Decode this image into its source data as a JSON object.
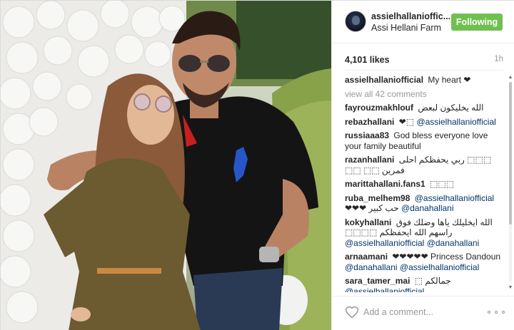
{
  "post": {
    "username": "assielhallaniofficial",
    "username_display": "assielhallanioffic...",
    "location": "Assi Hellani Farm",
    "follow_button": "Following",
    "likes": "4,101 likes",
    "time_ago": "1h",
    "caption": {
      "user": "assielhallaniofficial",
      "text": "My heart ❤"
    },
    "view_all": "view all 42 comments"
  },
  "comments": [
    {
      "user": "fayrouzmakhlouf",
      "text": "الله يخليكون لبعض"
    },
    {
      "user": "rebazhallani",
      "text": "❤⬚",
      "mention": "@assielhallaniofficial"
    },
    {
      "user": "russiaaa83",
      "text": "God bless everyone love your family beautiful"
    },
    {
      "user": "razanhallani",
      "text": "⬚⬚⬚ ربي يحفظكم احلى فمرين ⬚⬚ ⬚⬚"
    },
    {
      "user": "marittahallani.fans1",
      "text": "⬚⬚⬚"
    },
    {
      "user": "ruba_melhem98",
      "mention": "@assielhallaniofficial",
      "text": "حب كبير ❤❤❤",
      "mention2": "@danahallani"
    },
    {
      "user": "kokyhallani",
      "text": "الله ايخليلك ياها وضلك فوق راسهم الله ايحفظكم ⬚⬚⬚⬚",
      "mention": "@assielhallaniofficial",
      "mention2": "@danahallani"
    },
    {
      "user": "arnaamani",
      "text": "❤❤❤❤❤ Princess Dandoun",
      "mention": "@danahallani @assielhallaniofficial"
    },
    {
      "user": "sara_tamer_mai",
      "text": "جمالكم ⬚",
      "mention": "@assielhallaniofficial"
    }
  ],
  "footer": {
    "placeholder": "Add a comment..."
  },
  "colors": {
    "follow_green": "#70c050",
    "mention_blue": "#003569",
    "muted": "#999999"
  },
  "icons": [
    "heart-icon",
    "more-options-icon",
    "avatar"
  ]
}
